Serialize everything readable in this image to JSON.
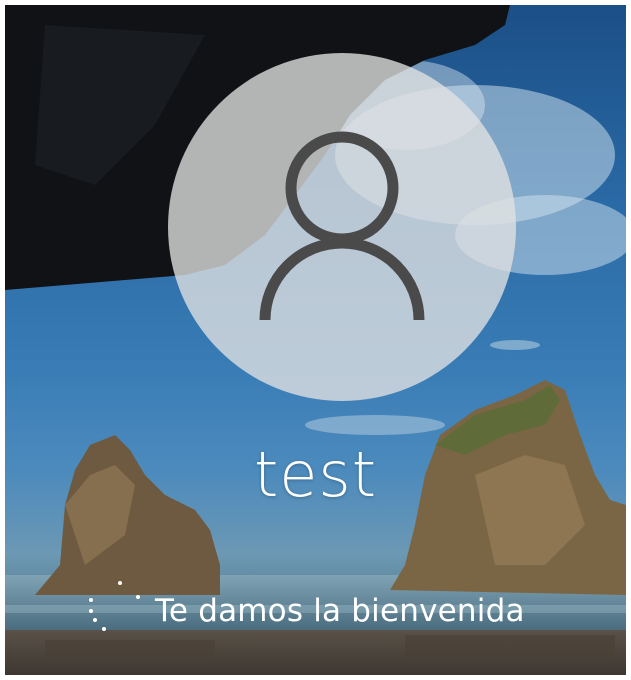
{
  "lock_screen": {
    "user": {
      "avatar_icon": "user-silhouette-icon",
      "name": "test"
    },
    "status": {
      "spinner_icon": "loading-dots-icon",
      "message": "Te damos la bienvenida"
    }
  },
  "colors": {
    "avatar_circle": "#e2e2e2",
    "avatar_glyph": "#4a4a4a",
    "text": "#ffffff"
  }
}
